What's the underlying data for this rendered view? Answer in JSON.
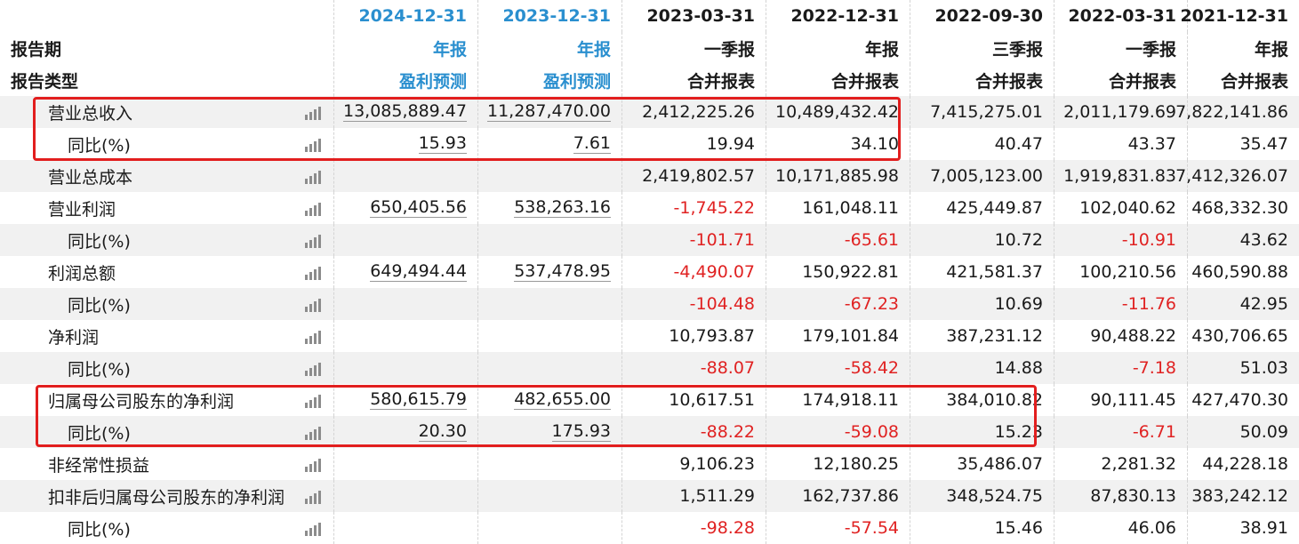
{
  "header": {
    "dates": [
      "2024-12-31",
      "2023-12-31",
      "2023-03-31",
      "2022-12-31",
      "2022-09-30",
      "2022-03-31",
      "2021-12-31"
    ],
    "period_label": "报告期",
    "periods": [
      "年报",
      "年报",
      "一季报",
      "年报",
      "三季报",
      "一季报",
      "年报"
    ],
    "type_label": "报告类型",
    "types": [
      "盈利预测",
      "盈利预测",
      "合并报表",
      "合并报表",
      "合并报表",
      "合并报表",
      "合并报表"
    ]
  },
  "rows": [
    {
      "label": "营业总收入",
      "values": [
        "13,085,889.47",
        "11,287,470.00",
        "2,412,225.26",
        "10,489,432.42",
        "7,415,275.01",
        "2,011,179.69",
        "7,822,141.86"
      ]
    },
    {
      "label": "同比(%)",
      "values": [
        "15.93",
        "7.61",
        "19.94",
        "34.10",
        "40.47",
        "43.37",
        "35.47"
      ]
    },
    {
      "label": "营业总成本",
      "values": [
        "",
        "",
        "2,419,802.57",
        "10,171,885.98",
        "7,005,123.00",
        "1,919,831.83",
        "7,412,326.07"
      ]
    },
    {
      "label": "营业利润",
      "values": [
        "650,405.56",
        "538,263.16",
        "-1,745.22",
        "161,048.11",
        "425,449.87",
        "102,040.62",
        "468,332.30"
      ]
    },
    {
      "label": "同比(%)",
      "values": [
        "",
        "",
        "-101.71",
        "-65.61",
        "10.72",
        "-10.91",
        "43.62"
      ]
    },
    {
      "label": "利润总额",
      "values": [
        "649,494.44",
        "537,478.95",
        "-4,490.07",
        "150,922.81",
        "421,581.37",
        "100,210.56",
        "460,590.88"
      ]
    },
    {
      "label": "同比(%)",
      "values": [
        "",
        "",
        "-104.48",
        "-67.23",
        "10.69",
        "-11.76",
        "42.95"
      ]
    },
    {
      "label": "净利润",
      "values": [
        "",
        "",
        "10,793.87",
        "179,101.84",
        "387,231.12",
        "90,488.22",
        "430,706.65"
      ]
    },
    {
      "label": "同比(%)",
      "values": [
        "",
        "",
        "-88.07",
        "-58.42",
        "14.88",
        "-7.18",
        "51.03"
      ]
    },
    {
      "label": "归属母公司股东的净利润",
      "values": [
        "580,615.79",
        "482,655.00",
        "10,617.51",
        "174,918.11",
        "384,010.82",
        "90,111.45",
        "427,470.30"
      ]
    },
    {
      "label": "同比(%)",
      "values": [
        "20.30",
        "175.93",
        "-88.22",
        "-59.08",
        "15.23",
        "-6.71",
        "50.09"
      ]
    },
    {
      "label": "非经常性损益",
      "values": [
        "",
        "",
        "9,106.23",
        "12,180.25",
        "35,486.07",
        "2,281.32",
        "44,228.18"
      ]
    },
    {
      "label": "扣非后归属母公司股东的净利润",
      "values": [
        "",
        "",
        "1,511.29",
        "162,737.86",
        "348,524.75",
        "87,830.13",
        "383,242.12"
      ]
    },
    {
      "label": "同比(%)",
      "values": [
        "",
        "",
        "-98.28",
        "-57.54",
        "15.46",
        "46.06",
        "38.91"
      ]
    }
  ],
  "colors": {
    "date_blue": "#2a8fcf",
    "negative_red": "#e02222",
    "highlight_box": "#e21e1e",
    "stripe": "#f1f1f1"
  }
}
